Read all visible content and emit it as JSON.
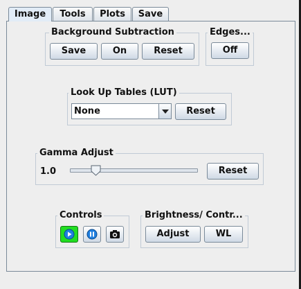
{
  "tabs": [
    {
      "label": "Image"
    },
    {
      "label": "Tools"
    },
    {
      "label": "Plots"
    },
    {
      "label": "Save"
    }
  ],
  "background_subtraction": {
    "title": "Background Subtraction",
    "save_label": "Save",
    "on_label": "On",
    "reset_label": "Reset"
  },
  "edges": {
    "title": "Edges...",
    "off_label": "Off"
  },
  "lut": {
    "title": "Look Up Tables (LUT)",
    "selected": "None",
    "reset_label": "Reset"
  },
  "gamma": {
    "title": "Gamma Adjust",
    "value": "1.0",
    "slider_fraction": 0.2,
    "reset_label": "Reset"
  },
  "controls": {
    "title": "Controls",
    "play_icon": "play-icon",
    "pause_icon": "pause-icon",
    "camera_icon": "camera-icon",
    "active_color": "#22dd22"
  },
  "brightness": {
    "title": "Brightness/ Contr...",
    "adjust_label": "Adjust",
    "wl_label": "WL"
  }
}
